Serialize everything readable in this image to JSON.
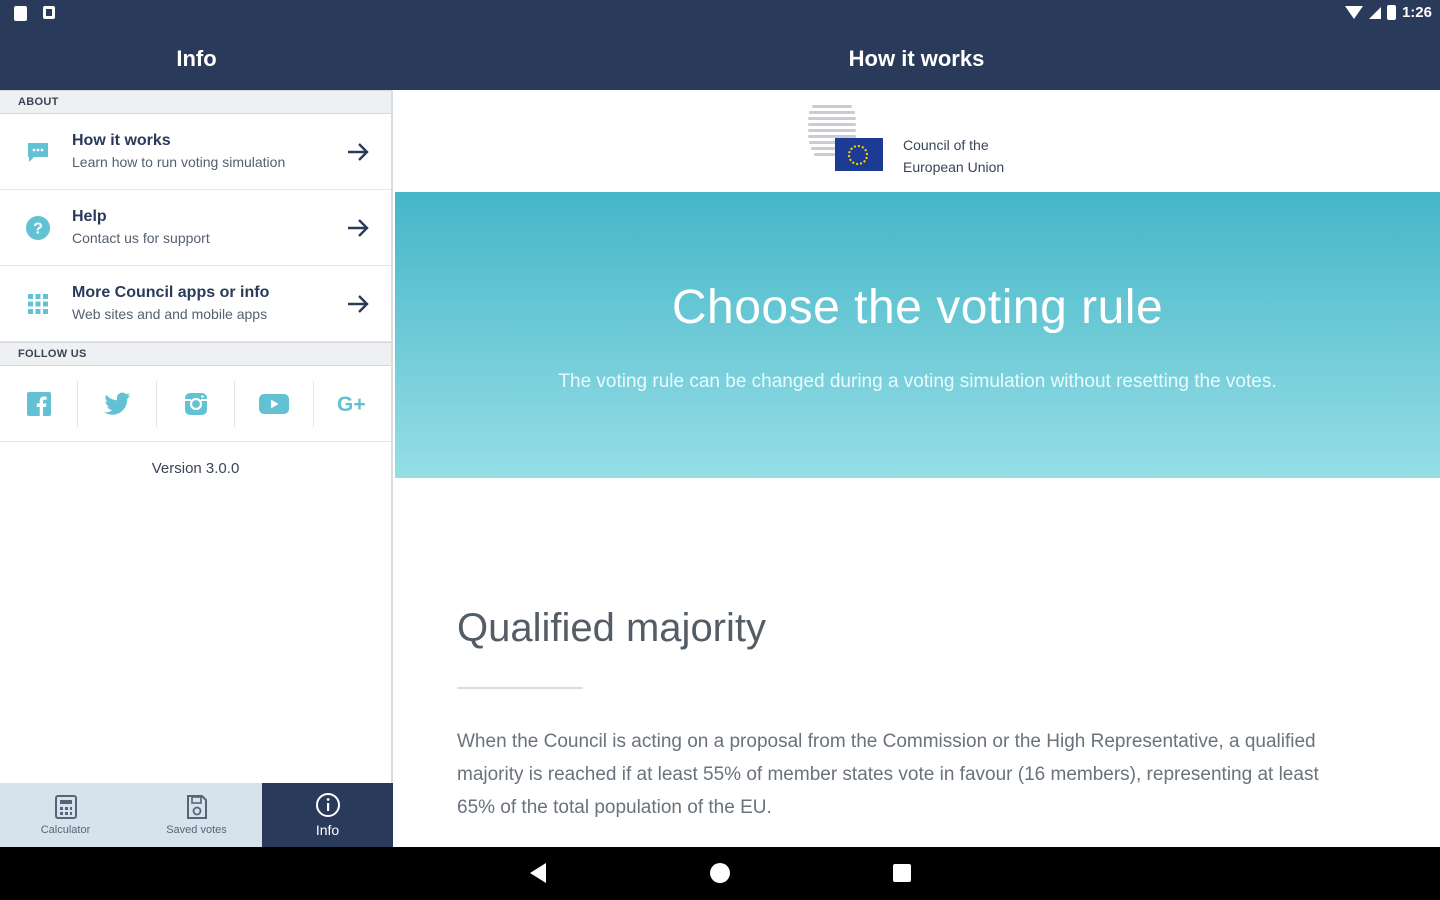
{
  "status_bar": {
    "time": "1:26"
  },
  "left_header": {
    "title": "Info"
  },
  "right_header": {
    "title": "How it works"
  },
  "sidebar": {
    "about_header": "ABOUT",
    "items": [
      {
        "title": "How it works",
        "subtitle": "Learn how to run voting simulation",
        "icon": "chat-icon"
      },
      {
        "title": "Help",
        "subtitle": "Contact us for support",
        "icon": "help-icon"
      },
      {
        "title": "More Council apps or info",
        "subtitle": "Web sites and and mobile apps",
        "icon": "grid-icon"
      }
    ],
    "follow_header": "FOLLOW US",
    "social": [
      "facebook-icon",
      "twitter-icon",
      "instagram-icon",
      "youtube-icon",
      "google-plus-icon"
    ],
    "version": "Version 3.0.0"
  },
  "bottom_nav": {
    "tabs": [
      {
        "label": "Calculator",
        "icon": "calculator-icon",
        "active": false
      },
      {
        "label": "Saved votes",
        "icon": "save-icon",
        "active": false
      },
      {
        "label": "Info",
        "icon": "info-icon",
        "active": true
      }
    ]
  },
  "content": {
    "logo_line1": "Council of the",
    "logo_line2": "European Union",
    "hero_title": "Choose the voting rule",
    "hero_subtitle": "The voting rule can be changed during a voting simulation without resetting the votes.",
    "section_title": "Qualified majority",
    "section_text": "When the Council is acting on a proposal from the Commission or the High Representative, a qualified majority is reached if at least 55% of member states vote in favour (16 members), representing at least 65% of the total population of the EU."
  },
  "colors": {
    "primary": "#2a3a5a",
    "accent": "#45b6c8",
    "icon": "#62c1d2"
  }
}
